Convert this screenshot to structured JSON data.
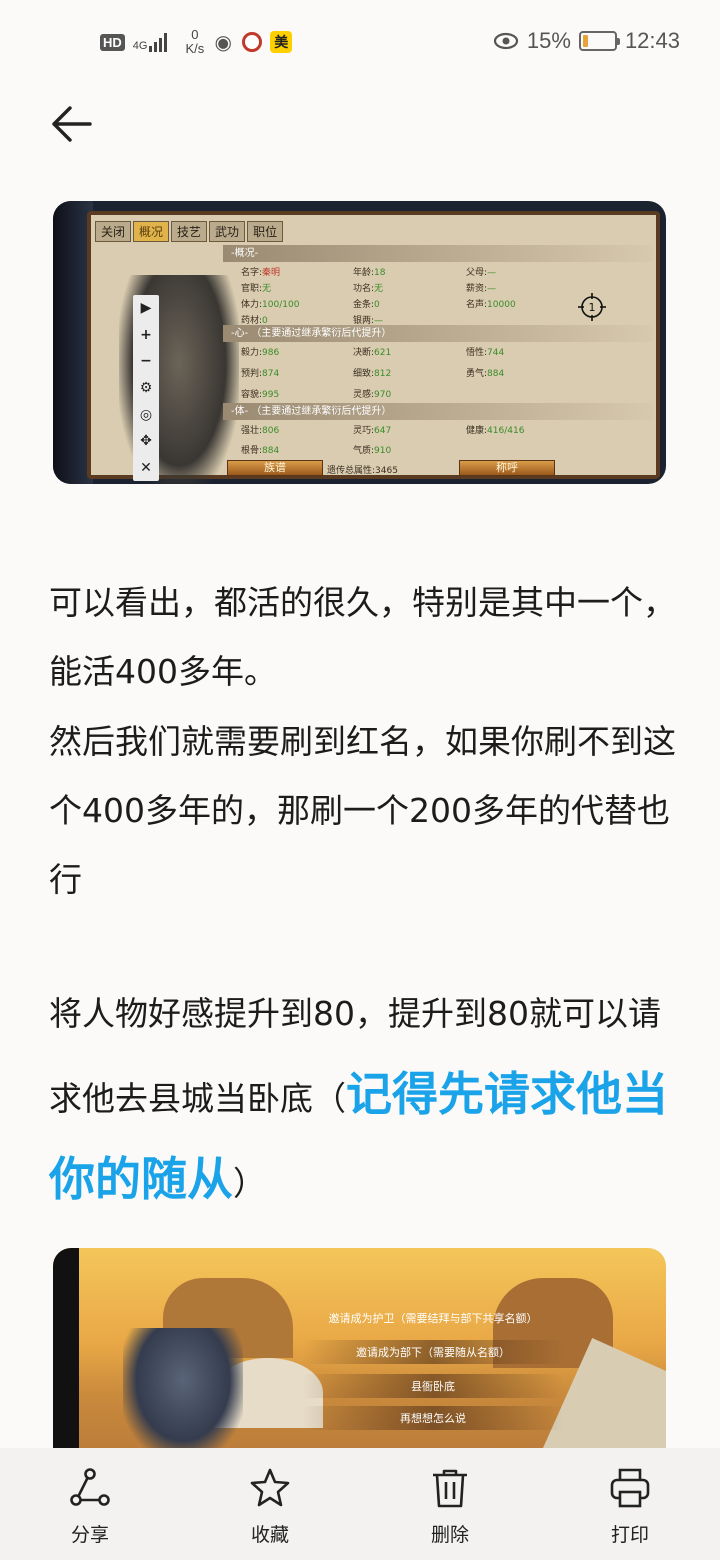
{
  "status": {
    "hd": "HD",
    "network": "4G",
    "speed_value": "0",
    "speed_unit": "K/s",
    "app_badge": "美",
    "battery_text": "15%",
    "battery_level": 0.15,
    "time": "12:43"
  },
  "game1": {
    "tabs": [
      "关闭",
      "概况",
      "技艺",
      "武功",
      "职位"
    ],
    "section_overview": "-概况-",
    "section_heart": "-心-  （主要通过继承繁衍后代提升）",
    "section_body": "-体-  （主要通过继承繁衍后代提升）",
    "stats": {
      "name_label": "名字:",
      "name_value": "秦明",
      "age_label": "年龄:",
      "age_value": "18",
      "parents_label": "父母:",
      "parents_value": "—",
      "office_label": "官职:",
      "office_value": "无",
      "merit_label": "功名:",
      "merit_value": "无",
      "salary_label": "薪资:",
      "salary_value": "—",
      "stamina_label": "体力:",
      "stamina_value": "100/100",
      "gold_label": "金条:",
      "gold_value": "0",
      "fame_label": "名声:",
      "fame_value": "10000",
      "herb_label": "药材:",
      "herb_value": "0",
      "silver_label": "银两:",
      "silver_value": "—",
      "perseverance_label": "毅力:",
      "perseverance_value": "986",
      "decisive_label": "决断:",
      "decisive_value": "621",
      "insight_label": "悟性:",
      "insight_value": "744",
      "foresight_label": "预判:",
      "foresight_value": "874",
      "careful_label": "细致:",
      "careful_value": "812",
      "courage_label": "勇气:",
      "courage_value": "884",
      "tolerance_label": "容貌:",
      "tolerance_value": "995",
      "inspiration_label": "灵感:",
      "inspiration_value": "970",
      "strong_label": "强壮:",
      "strong_value": "806",
      "agile_label": "灵巧:",
      "agile_value": "647",
      "health_label": "健康:",
      "health_value": "416/416",
      "bone_label": "根骨:",
      "bone_value": "884",
      "temperament_label": "气质:",
      "temperament_value": "910"
    },
    "btn_clan": "族谱",
    "heritage_label": "遗传总属性:",
    "heritage_value": "3465",
    "btn_title": "称呼",
    "toolbar": [
      "▶",
      "+",
      "−",
      "⚙",
      "◎",
      "✥",
      "✕"
    ],
    "target_number": "1"
  },
  "article": {
    "p1": "可以看出，都活的很久，特别是其中一个，能活400多年。",
    "p2": "然后我们就需要刷到红名，如果你刷不到这个400多年的，那刷一个200多年的代替也行",
    "p3_start": "将人物好感提升到80，提升到80就可以请求他去县城当卧底（",
    "p3_highlight": "记得先请求他当你的随从",
    "p3_end": "）"
  },
  "game2": {
    "line1": "邀请成为护卫（需要结拜与部下共享名额）",
    "line2": "邀请成为部下（需要随从名额）",
    "line3": "县衙卧底",
    "line4": "再想想怎么说"
  },
  "bottom": {
    "share": "分享",
    "favorite": "收藏",
    "delete": "删除",
    "print": "打印"
  },
  "colors": {
    "highlight": "#1aa3e8",
    "text": "#1c1c1c",
    "battery_fill": "#e8a23a"
  }
}
